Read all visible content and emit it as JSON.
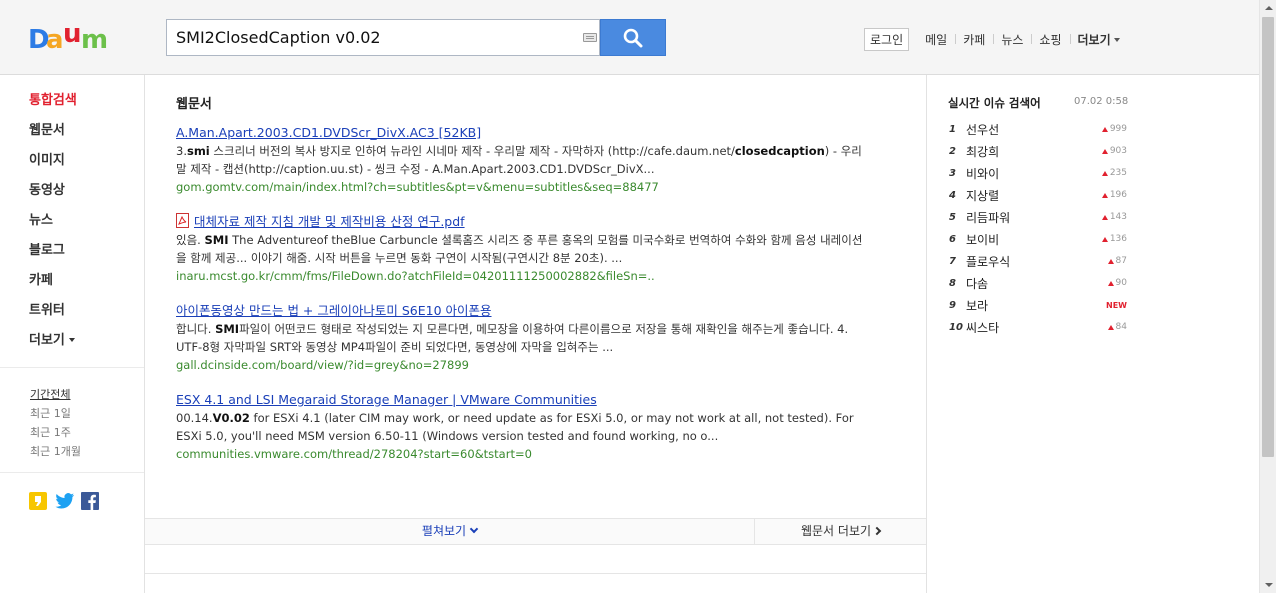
{
  "header": {
    "logo_text": "Daum",
    "logo_colors": [
      "#2c7be5",
      "#f5a623",
      "#e1212f",
      "#6cc04a"
    ],
    "search_value": "SMI2ClosedCaption v0.02",
    "keyboard_icon": "keyboard-icon",
    "search_icon": "search-icon",
    "login_label": "로그인",
    "nav": [
      "메일",
      "카페",
      "뉴스",
      "쇼핑",
      "더보기"
    ]
  },
  "leftnav": {
    "categories": [
      "통합검색",
      "웹문서",
      "이미지",
      "동영상",
      "뉴스",
      "블로그",
      "카페",
      "트위터",
      "더보기"
    ],
    "periods": [
      "기간전체",
      "최근 1일",
      "최근 1주",
      "최근 1개월"
    ],
    "share_icons": [
      "daum-share-icon",
      "twitter-icon",
      "facebook-icon"
    ]
  },
  "main": {
    "section_title": "웹문서",
    "results": [
      {
        "title": "A.Man.Apart.2003.CD1.DVDScr_DivX.AC3 [52KB]",
        "desc_html": "3.<b>smi</b> 스크리너 버전의 복사 방지로 인하여 뉴라인 시네마 제작 - 우리말 제작 - 자막하자 (http://cafe.daum.net/<b>closedcaption</b>) - 우리말 제작 - 캡션(http://caption.uu.st) - 씽크 수정 - A.Man.Apart.2003.CD1.DVDScr_DivX...",
        "url": "gom.gomtv.com/main/index.html?ch=subtitles&pt=v&menu=subtitles&seq=88477"
      },
      {
        "title": "대체자료 제작 지침 개발 및 제작비용 산정 연구.pdf",
        "desc_html": "있음. <b>SMI</b> The Adventureof theBlue Carbuncle 셜록홈즈 시리즈 중 푸른 홍옥의 모험를 미국수화로 번역하여 수화와 함께 음성 내레이션을 함께 제공... 이야기 해줌. 시작 버튼을 누르면 동화 구연이 시작됨(구연시간 8분 20초). ...",
        "url": "inaru.mcst.go.kr/cmm/fms/FileDown.do?atchFileId=04201111250002882&fileSn=.."
      },
      {
        "title": "아이폰동영상 만드는 법 + 그레이아나토미 S6E10 아이폰용",
        "desc_html": "합니다. <b>SMI</b>파일이 어떤코드 형태로 작성되었는 지 모른다면, 메모장을 이용하여 다른이름으로 저장을 통해 재확인을 해주는게 좋습니다. 4. UTF-8형 자막파일 SRT와 동영상 MP4파일이 준비 되었다면, 동영상에 자막을 입혀주는 ...",
        "url": "gall.dcinside.com/board/view/?id=grey&no=27899"
      },
      {
        "title": "ESX 4.1 and LSI Megaraid Storage Manager | VMware Communities",
        "desc_html": "00.14.<b>V0.02</b> for ESXi 4.1 (later CIM may work, or need update as for ESXi 5.0, or may not work at all, not tested). For ESXi 5.0, you'll need MSM version 6.50-11 (Windows version tested and found working, no o...",
        "url": "communities.vmware.com/thread/278204?start=60&tstart=0"
      }
    ],
    "expand_label": "펼쳐보기",
    "more_label": "웹문서 더보기"
  },
  "realtime": {
    "title": "실시간 이슈 검색어",
    "date": "07.02  0:58",
    "items": [
      {
        "rank": "1",
        "keyword": "선우선",
        "change": "999",
        "new": false
      },
      {
        "rank": "2",
        "keyword": "최강희",
        "change": "903",
        "new": false
      },
      {
        "rank": "3",
        "keyword": "비와이",
        "change": "235",
        "new": false
      },
      {
        "rank": "4",
        "keyword": "지상렬",
        "change": "196",
        "new": false
      },
      {
        "rank": "5",
        "keyword": "리듬파워",
        "change": "143",
        "new": false
      },
      {
        "rank": "6",
        "keyword": "보이비",
        "change": "136",
        "new": false
      },
      {
        "rank": "7",
        "keyword": "플로우식",
        "change": "87",
        "new": false
      },
      {
        "rank": "8",
        "keyword": "다솜",
        "change": "90",
        "new": false
      },
      {
        "rank": "9",
        "keyword": "보라",
        "change": "NEW",
        "new": true
      },
      {
        "rank": "10",
        "keyword": "씨스타",
        "change": "84",
        "new": false
      }
    ]
  }
}
